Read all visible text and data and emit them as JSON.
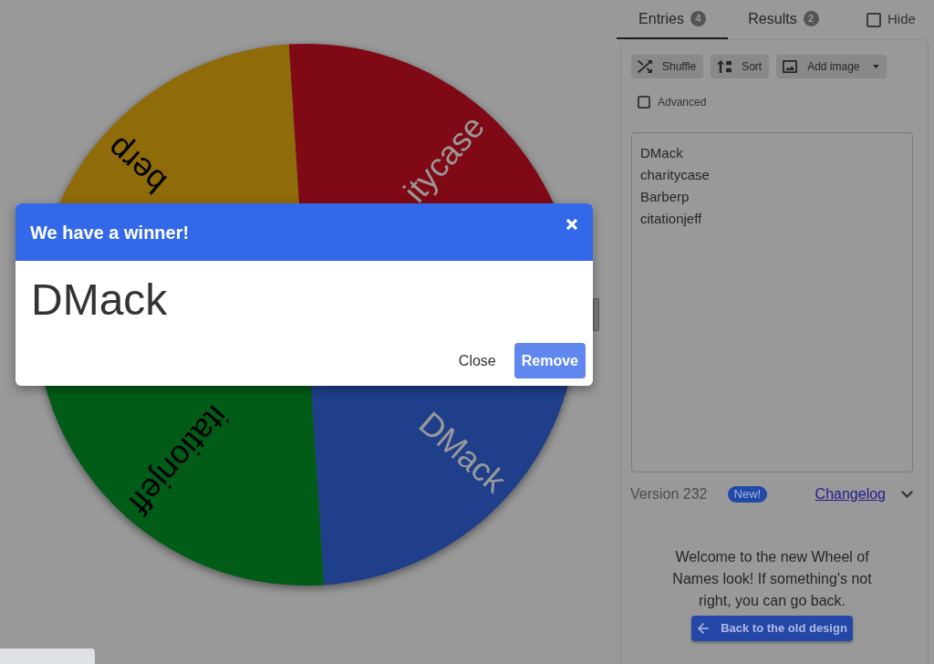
{
  "wheel": {
    "segments": [
      {
        "label": "berp",
        "color": "#8f6b0a"
      },
      {
        "label": "itycase",
        "color": "#800916"
      },
      {
        "label": "DMack",
        "color": "#1f3f8b"
      },
      {
        "label": "itationjeff",
        "color": "#005c16"
      }
    ]
  },
  "winner_dialog": {
    "title": "We have a winner!",
    "winner": "DMack",
    "buttons": [
      {
        "label": "Close",
        "kind": "plain"
      },
      {
        "label": "Remove",
        "kind": "primary"
      }
    ]
  },
  "tabs": [
    {
      "label": "Entries",
      "count": "4",
      "selected": true
    },
    {
      "label": "Results",
      "count": "2",
      "selected": false
    }
  ],
  "hide_option": {
    "label": "Hide",
    "checked": false
  },
  "toolbar": [
    {
      "label": "Shuffle",
      "kind": "button"
    },
    {
      "label": "Sort",
      "kind": "button"
    },
    {
      "label": "Add image",
      "kind": "dropdown"
    }
  ],
  "advanced_option": {
    "label": "Advanced",
    "checked": false
  },
  "entries": [
    "DMack",
    "charitycase",
    "Barberp",
    "citationjeff"
  ],
  "version": {
    "label": "Version 232",
    "badge": "New!",
    "link": "Changelog"
  },
  "welcome": {
    "message": "Welcome to the new Wheel of Names look! If something's not right, you can go back.",
    "button": "Back to the old design"
  }
}
